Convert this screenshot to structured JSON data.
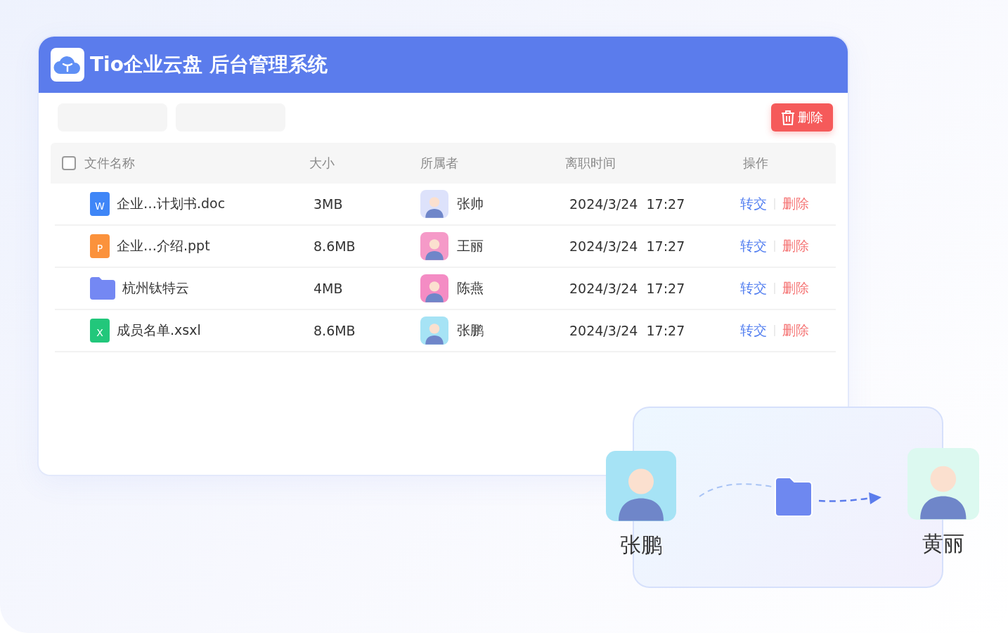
{
  "window": {
    "title": "Tio企业云盘 后台管理系统"
  },
  "toolbar": {
    "delete_button": "删除"
  },
  "table": {
    "select_all": {
      "checked": false
    },
    "columns": [
      "文件名称",
      "大小",
      "所属者",
      "离职时间",
      "操作"
    ],
    "rows": [
      {
        "kind": "doc",
        "badge": "W",
        "name": "企业…计划书.doc",
        "size": "3MB",
        "owner": {
          "name": "张帅",
          "color": "#dde2fb"
        },
        "time": "2024/3/24  17:27",
        "actions": [
          "转交",
          "删除"
        ]
      },
      {
        "kind": "ppt",
        "badge": "P",
        "name": "企业…介绍.ppt",
        "size": "8.6MB",
        "owner": {
          "name": "王丽",
          "color": "#f59ac8"
        },
        "time": "2024/3/24  17:27",
        "actions": [
          "转交",
          "删除"
        ]
      },
      {
        "kind": "folder",
        "name": "杭州钛特云",
        "size": "4MB",
        "owner": {
          "name": "陈燕",
          "color": "#f48cc4"
        },
        "time": "2024/3/24  17:27",
        "actions": [
          "转交",
          "删除"
        ]
      },
      {
        "kind": "xls",
        "badge": "X",
        "name": "成员名单.xsxl",
        "size": "8.6MB",
        "owner": {
          "name": "张鹏",
          "color": "#a6e3f5"
        },
        "time": "2024/3/24  17:27",
        "actions": [
          "转交",
          "删除"
        ]
      }
    ]
  },
  "transfer": {
    "from": {
      "name": "张鹏",
      "color": "#a6e3f5"
    },
    "to": {
      "name": "黄丽",
      "color": "#dcf9f0"
    }
  }
}
